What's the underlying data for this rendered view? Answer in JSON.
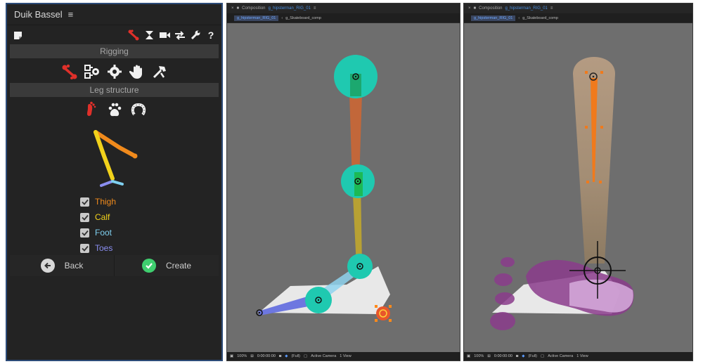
{
  "duik": {
    "title": "Duik Bassel",
    "menu_icon": "≡",
    "toolbar": {
      "icons": [
        "note-icon",
        "bone-icon",
        "hourglass-icon",
        "camera-icon",
        "swap-icon",
        "wrench-icon"
      ],
      "help": "?"
    },
    "rigging_label": "Rigging",
    "leg_structure_label": "Leg structure",
    "limbs": [
      {
        "label": "Thigh",
        "color": "#f08a1c"
      },
      {
        "label": "Calf",
        "color": "#f2d21b"
      },
      {
        "label": "Foot",
        "color": "#7fd0f0"
      },
      {
        "label": "Toes",
        "color": "#8a8ef0"
      }
    ],
    "back_label": "Back",
    "create_label": "Create",
    "accent_red": "#e0302a",
    "create_green": "#3fcf6f"
  },
  "comp_left": {
    "header_prefix": "Composition",
    "comp_name": "g_hipsterman_RIG_01",
    "tabs": [
      "g_hipsterman_RIG_01",
      "g_Skateboard_comp"
    ],
    "footer": {
      "zoom": "100%",
      "timecode": "0:00:00:00",
      "resolution": "(Full)",
      "camera": "Active Camera",
      "views": "1 View"
    }
  },
  "comp_right": {
    "header_prefix": "Composition",
    "comp_name": "g_hipsterman_RIG_01",
    "tabs": [
      "g_hipsterman_RIG_01",
      "g_Skateboard_comp"
    ],
    "footer": {
      "zoom": "100%",
      "timecode": "0:00:00:00",
      "resolution": "(Full)",
      "camera": "Active Camera",
      "views": "1 View"
    }
  }
}
